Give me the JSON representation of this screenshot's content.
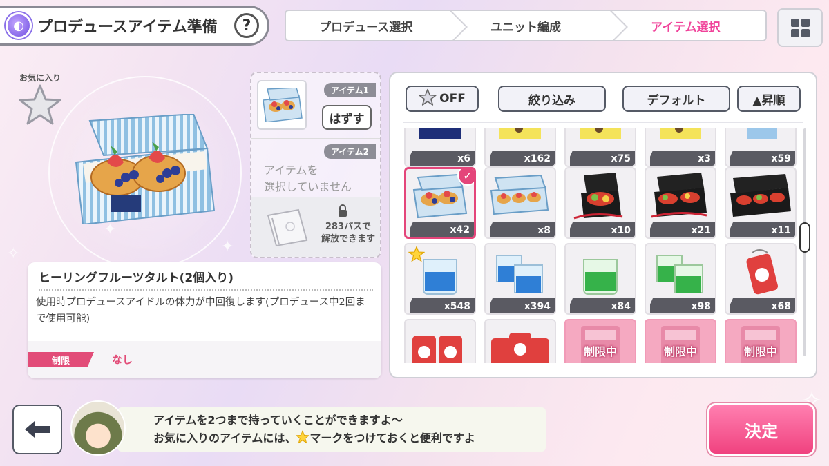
{
  "header": {
    "title": "プロデュースアイテム準備",
    "help_label": "?",
    "steps": [
      "プロデュース選択",
      "ユニット編成",
      "アイテム選択"
    ],
    "active_step": 2
  },
  "detail": {
    "favorite_label": "お気に入り",
    "item_name": "ヒーリングフルーツタルト(2個入り)",
    "item_description": "使用時プロデュースアイドルの体力が中回復します(プロデュース中2回まで使用可能)",
    "limit_label": "制限",
    "limit_value": "なし"
  },
  "slots": {
    "slot1_tag": "アイテム1",
    "remove_label": "はずす",
    "slot2_tag": "アイテム2",
    "slot2_empty_line1": "アイテムを",
    "slot2_empty_line2": "選択していません",
    "slot3_line1": "283パスで",
    "slot3_line2": "解放できます"
  },
  "list": {
    "favorite_toggle": "OFF",
    "filter_label": "絞り込み",
    "sort_label": "デフォルト",
    "order_label": "▲昇順",
    "restricted_label": "制限中",
    "rows": [
      [
        {
          "count": "x6",
          "art": "navy"
        },
        {
          "count": "x162",
          "art": "yellow"
        },
        {
          "count": "x75",
          "art": "yellow"
        },
        {
          "count": "x3",
          "art": "yellow"
        },
        {
          "count": "x59",
          "art": "blue"
        }
      ],
      [
        {
          "count": "x42",
          "art": "tart1",
          "selected": true
        },
        {
          "count": "x8",
          "art": "tart2"
        },
        {
          "count": "x10",
          "art": "box1"
        },
        {
          "count": "x21",
          "art": "box2"
        },
        {
          "count": "x11",
          "art": "box3"
        }
      ],
      [
        {
          "count": "x548",
          "art": "candle-blue1",
          "favorite": true
        },
        {
          "count": "x394",
          "art": "candle-blue2"
        },
        {
          "count": "x84",
          "art": "candle-green1"
        },
        {
          "count": "x98",
          "art": "candle-green2"
        },
        {
          "count": "x68",
          "art": "charm1"
        }
      ],
      [
        {
          "count": "",
          "art": "charm2"
        },
        {
          "count": "",
          "art": "charm3"
        },
        {
          "count": "",
          "art": "card",
          "restricted": true
        },
        {
          "count": "",
          "art": "card",
          "restricted": true
        },
        {
          "count": "",
          "art": "card",
          "restricted": true
        }
      ]
    ]
  },
  "bottom": {
    "message_line1": "アイテムを2つまで持っていくことができますよ～",
    "message_line2_before": "お気に入りのアイテムには、",
    "message_line2_after": "マークをつけておくと便利ですよ",
    "confirm_label": "決定"
  },
  "colors": {
    "accent_pink": "#f0439a",
    "confirm_pink": "#f0427f",
    "limit_red": "#e24c78"
  }
}
